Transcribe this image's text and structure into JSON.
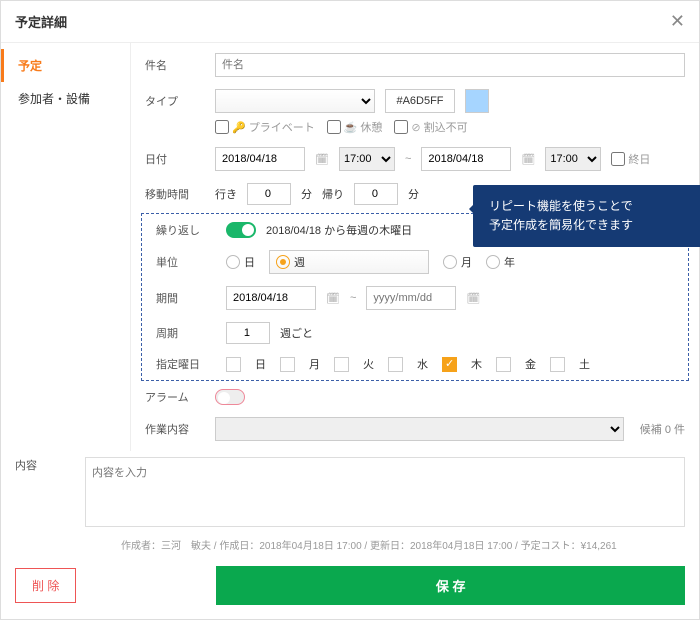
{
  "modal": {
    "title": "予定詳細"
  },
  "tabs": {
    "schedule": "予定",
    "attendees": "参加者・設備"
  },
  "fields": {
    "subject_label": "件名",
    "subject_placeholder": "件名",
    "type_label": "タイプ",
    "type_color": "#A6D5FF",
    "private": "プライベート",
    "break": "休憩",
    "noint": "割込不可",
    "date_label": "日付",
    "date_start": "2018/04/18",
    "time_start": "17:00",
    "date_end": "2018/04/18",
    "time_end": "17:00",
    "allday": "終日",
    "travel_label": "移動時間",
    "go": "行き",
    "go_val": "0",
    "min1": "分",
    "back": "帰り",
    "back_val": "0",
    "min2": "分",
    "repeat_label": "繰り返し",
    "repeat_desc": "2018/04/18 から毎週の木曜日",
    "unit_label": "単位",
    "unit_day": "日",
    "unit_week": "週",
    "unit_month": "月",
    "unit_year": "年",
    "period_label": "期間",
    "period_start": "2018/04/18",
    "period_end_placeholder": "yyyy/mm/dd",
    "cycle_label": "周期",
    "cycle_val": "1",
    "cycle_suffix": "週ごと",
    "days_label": "指定曜日",
    "d_sun": "日",
    "d_mon": "月",
    "d_tue": "火",
    "d_wed": "水",
    "d_thu": "木",
    "d_fri": "金",
    "d_sat": "土",
    "alarm_label": "アラーム",
    "work_label": "作業内容",
    "work_suffix": "候補 0 件",
    "content_label": "内容",
    "content_placeholder": "内容を入力"
  },
  "callout": {
    "line1": "リピート機能を使うことで",
    "line2": "予定作成を簡易化できます"
  },
  "footer": "作成者：三河　敏夫 / 作成日：2018年04月18日 17:00 / 更新日：2018年04月18日 17:00 / 予定コスト：¥14,261",
  "actions": {
    "delete": "削 除",
    "save": "保 存"
  }
}
